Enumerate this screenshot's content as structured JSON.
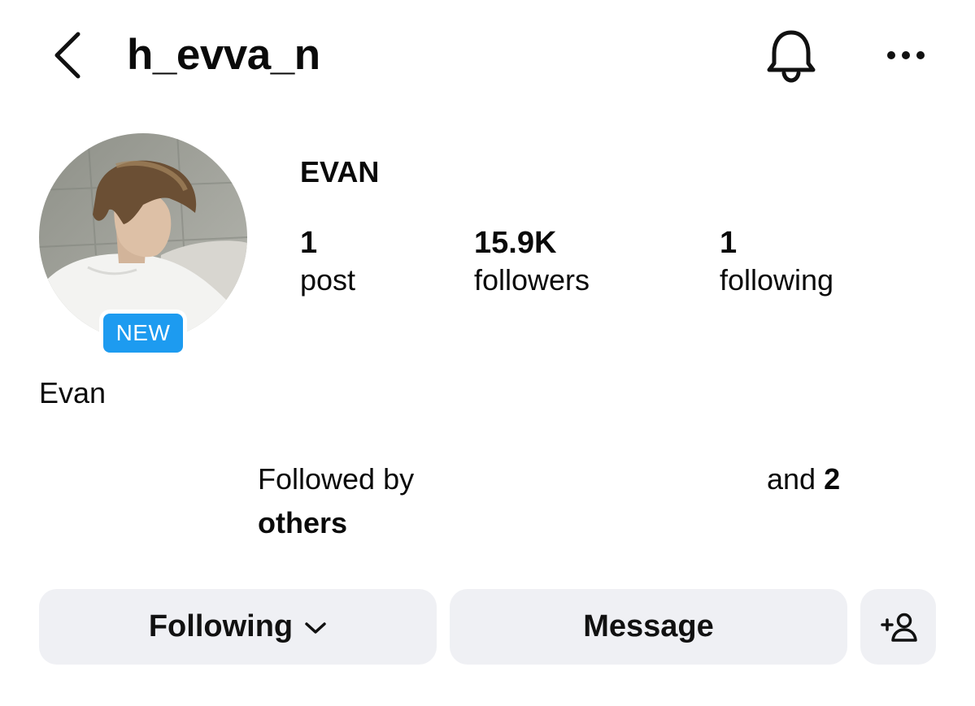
{
  "header": {
    "username": "h_evva_n",
    "icons": {
      "back": "back-chevron-icon",
      "bell": "bell-icon",
      "more": "more-dots-icon"
    }
  },
  "profile": {
    "badge": "NEW",
    "name": "Evan",
    "display_name": "EVAN"
  },
  "stats": [
    {
      "value": "1",
      "label": "post"
    },
    {
      "value": "15.9K",
      "label": "followers"
    },
    {
      "value": "1",
      "label": "following"
    }
  ],
  "followed_by": {
    "prefix": "Followed by",
    "and_text": "and",
    "count": "2",
    "others": "others"
  },
  "actions": {
    "following_label": "Following",
    "message_label": "Message",
    "add_user_icon": "add-user-icon"
  },
  "colors": {
    "badge": "#1d9bf0",
    "button_bg": "#eff0f4",
    "text": "#0a0a0a"
  }
}
